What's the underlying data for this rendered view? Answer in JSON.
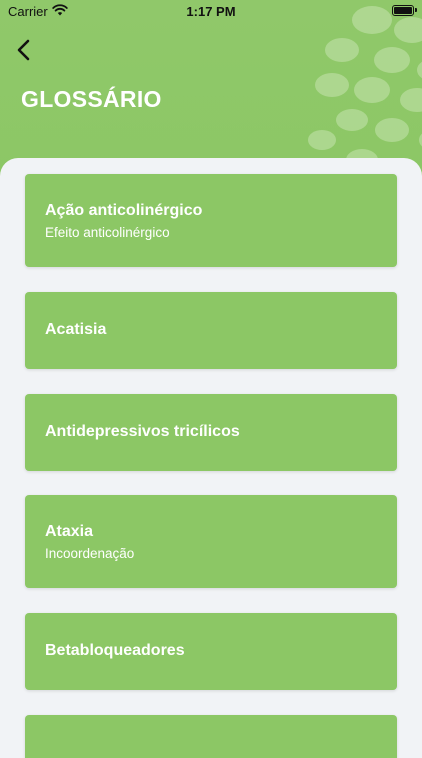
{
  "status_bar": {
    "carrier": "Carrier",
    "time": "1:17 PM"
  },
  "header": {
    "title": "GLOSSÁRIO",
    "back_icon": "chevron-left-icon"
  },
  "colors": {
    "accent": "#8cc765",
    "background": "#f1f3f6",
    "text_on_accent": "#ffffff"
  },
  "glossary": [
    {
      "term": "Ação anticolinérgico",
      "definition": "Efeito anticolinérgico"
    },
    {
      "term": "Acatisia"
    },
    {
      "term": "Antidepressivos tricílicos"
    },
    {
      "term": "Ataxia",
      "definition": "Incoordenação"
    },
    {
      "term": "Betabloqueadores"
    },
    {
      "term": ""
    }
  ]
}
